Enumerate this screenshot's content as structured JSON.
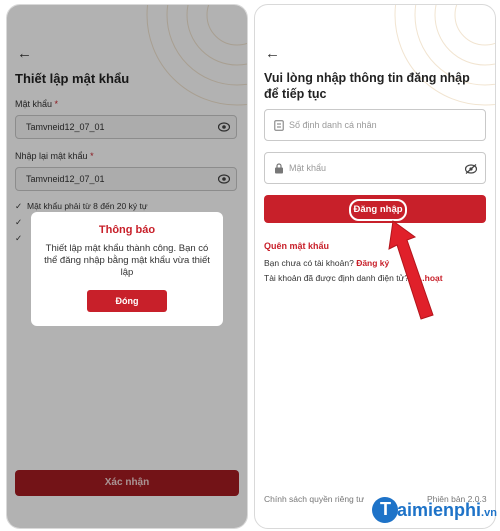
{
  "left_screen": {
    "title": "Thiết lập mật khẩu",
    "password_label": "Mật khẩu",
    "password_value": "Tamvneid12_07_01",
    "confirm_label": "Nhập lại mật khẩu",
    "confirm_value": "Tamvneid12_07_01",
    "rule_1": "Mật khẩu phải từ 8 đến 20 ký tự",
    "rule_mark": "✓",
    "dialog": {
      "title": "Thông báo",
      "message": "Thiết lập mật khẩu thành công. Bạn có thể đăng nhập bằng mật khẩu vừa thiết lập",
      "close_label": "Đóng"
    },
    "confirm_button": "Xác nhận"
  },
  "right_screen": {
    "title": "Vui lòng nhập thông tin đăng nhập để tiếp tục",
    "id_placeholder": "Số định danh cá nhân",
    "password_placeholder": "Mật khẩu",
    "login_button": "Đăng nhập",
    "forgot_password": "Quên mật khẩu",
    "no_account_text": "Bạn chưa có tài khoản?",
    "register_link": "Đăng ký",
    "activate_text": "Tài khoản đã được định danh điện tử?",
    "activate_link": "K...hoạt",
    "privacy_policy": "Chính sách quyền riêng tư",
    "version": "Phiên bản 2.0.3"
  },
  "watermark": {
    "initial": "T",
    "text": "aimienphi",
    "suffix": ".vn"
  },
  "colors": {
    "primary_red": "#c8202a",
    "dark_red": "#a51c22",
    "brand_blue": "#1e73c8"
  },
  "icons": [
    "back-arrow-icon",
    "eye-icon",
    "eye-off-icon",
    "id-card-icon",
    "lock-icon",
    "check-icon",
    "pointer-arrow-icon"
  ]
}
